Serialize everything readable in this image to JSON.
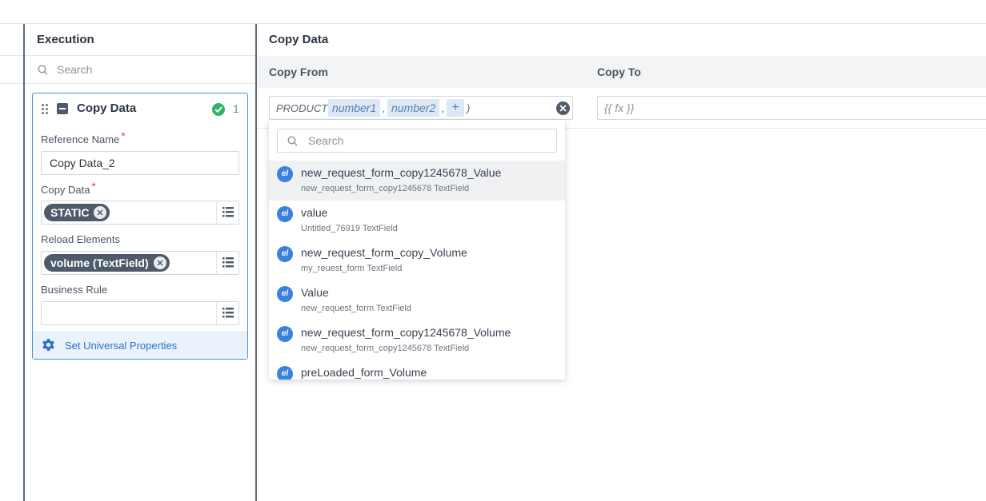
{
  "execution": {
    "title": "Execution",
    "search_placeholder": "Search",
    "card": {
      "title": "Copy Data",
      "count": "1",
      "reference_name_label": "Reference Name",
      "reference_name_value": "Copy Data_2",
      "copy_data_label": "Copy Data",
      "copy_data_chip": "STATIC",
      "reload_elements_label": "Reload Elements",
      "reload_elements_chip": "volume (TextField)",
      "business_rule_label": "Business Rule",
      "business_rule_value": "",
      "required_mark": "*",
      "universal_link": "Set Universal Properties"
    }
  },
  "copy_panel": {
    "title": "Copy Data",
    "col_from": "Copy From",
    "col_to": "Copy To",
    "formula": {
      "fn": "PRODUCT(",
      "args": [
        "number1",
        "number2"
      ],
      "sep": ",",
      "plus": "+",
      "close": ")"
    },
    "copy_to_placeholder": "{{ fx }}"
  },
  "dropdown": {
    "search_placeholder": "Search",
    "badge": "el",
    "items": [
      {
        "name": "new_request_form_copy1245678_Value",
        "sub": "new_request_form_copy1245678 TextField"
      },
      {
        "name": "value",
        "sub": "Untitled_76919 TextField"
      },
      {
        "name": "new_request_form_copy_Volume",
        "sub": "my_reuest_form TextField"
      },
      {
        "name": "Value",
        "sub": "new_request_form TextField"
      },
      {
        "name": "new_request_form_copy1245678_Volume",
        "sub": "new_request_form_copy1245678 TextField"
      },
      {
        "name": "preLoaded_form_Volume",
        "sub": ""
      }
    ]
  },
  "colors": {
    "accent": "#3b82e0",
    "card_border": "#4a90d9",
    "success": "#2fb36a",
    "chip": "#4f5b6a",
    "required": "#e24b4b"
  }
}
